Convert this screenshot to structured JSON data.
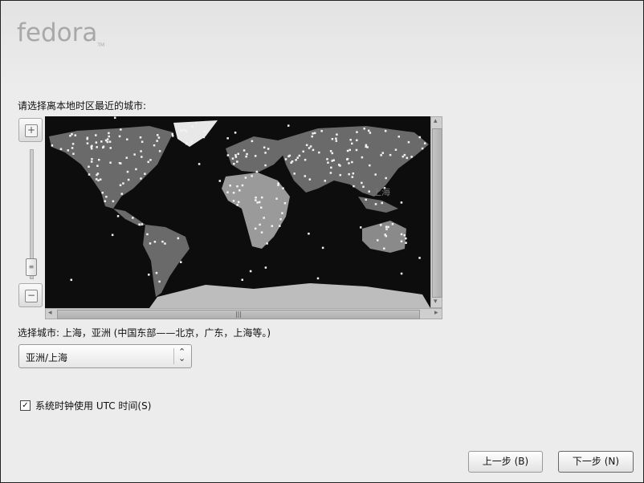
{
  "logo": {
    "text": "fedora",
    "tm": "TM"
  },
  "prompt": "请选择离本地时区最近的城市:",
  "zoom": {
    "in_icon": "zoom-in-icon",
    "out_icon": "zoom-out-icon"
  },
  "map": {
    "highlight_city": "上海"
  },
  "selected_label": "选择城市: 上海，亚洲 (中国东部——北京，广东，上海等。)",
  "timezone_select": {
    "value": "亚洲/上海"
  },
  "utc_checkbox": {
    "label": "系统时钟使用 UTC 时间(S)",
    "checked": true
  },
  "buttons": {
    "back": "上一步 (B)",
    "next": "下一步 (N)"
  }
}
